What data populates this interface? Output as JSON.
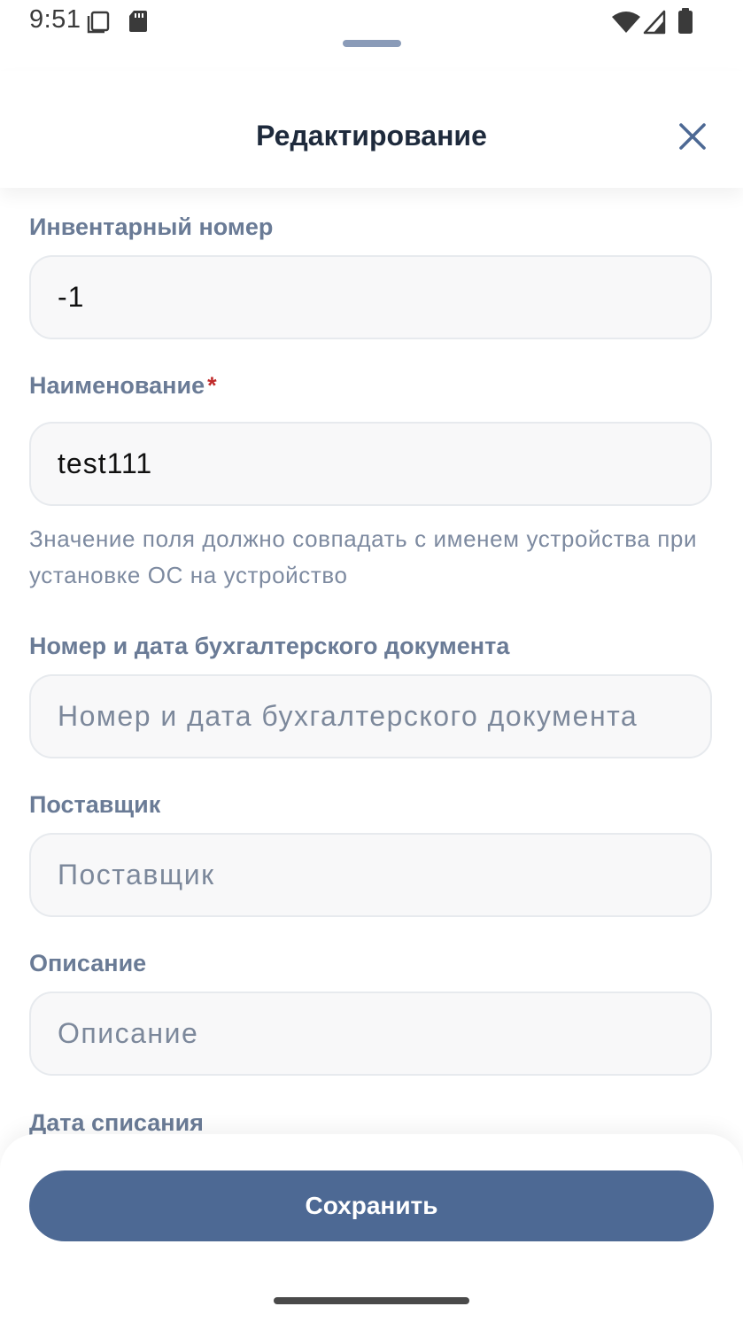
{
  "status_bar": {
    "time": "9:51",
    "icons": [
      "screenshot-icon",
      "sd-card-icon",
      "wifi-icon",
      "signal-icon",
      "battery-icon"
    ]
  },
  "header": {
    "title": "Редактирование",
    "close_icon": "close-icon"
  },
  "form": {
    "inventory_number": {
      "label": "Инвентарный номер",
      "value": "-1"
    },
    "name": {
      "label": "Наименование",
      "required_mark": "*",
      "value": "test111",
      "hint": "Значение поля должно совпадать с именем устройства при установке ОС на устройство"
    },
    "accounting_document": {
      "label": "Номер и дата бухгалтерского документа",
      "placeholder": "Номер и дата бухгалтерского документа",
      "value": ""
    },
    "supplier": {
      "label": "Поставщик",
      "placeholder": "Поставщик",
      "value": ""
    },
    "description": {
      "label": "Описание",
      "placeholder": "Описание",
      "value": ""
    },
    "write_off_date": {
      "label": "Дата списания"
    }
  },
  "footer": {
    "save_label": "Сохранить"
  },
  "colors": {
    "primary": "#4d6994",
    "label": "#6a7b96",
    "required": "#c02a2a",
    "title": "#1e2a3c"
  }
}
